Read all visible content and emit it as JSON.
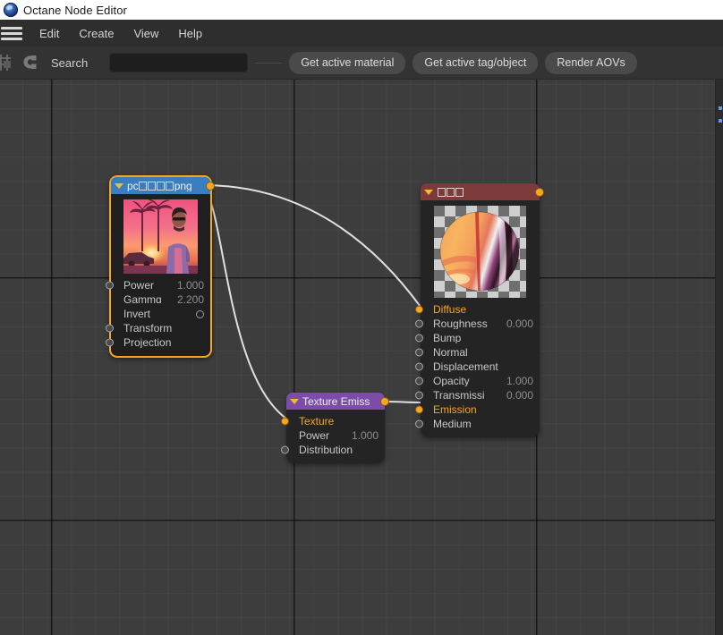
{
  "window": {
    "title": "Octane Node Editor",
    "logo_icon": "octane-logo-icon"
  },
  "menubar": {
    "hamburger_icon": "hamburger-menu-icon",
    "items": [
      {
        "label": "Edit"
      },
      {
        "label": "Create"
      },
      {
        "label": "View"
      },
      {
        "label": "Help"
      }
    ]
  },
  "toolbar": {
    "icons": [
      {
        "name": "node-graph-icon"
      },
      {
        "name": "magnet-snap-icon"
      }
    ],
    "search_label": "Search",
    "search_value": "",
    "search_placeholder": "",
    "buttons": [
      {
        "label": "Get active material"
      },
      {
        "label": "Get active tag/object"
      },
      {
        "label": "Render AOVs"
      }
    ]
  },
  "canvas": {
    "background_color": "#3d3d3d",
    "grid_minor_color": "#474747",
    "grid_major_color": "#262626",
    "wire_color": "#e0e0e0"
  },
  "nodes": {
    "image": {
      "title_prefix": "pc",
      "title_tofu_count": 4,
      "title_suffix": "png",
      "title_color": "#3a7ebf",
      "selected": true,
      "thumbnail": "sunset-palm-tree-portrait-thumbnail",
      "rows": [
        {
          "label": "Power",
          "value": "1.000",
          "port": true,
          "linked": false,
          "checkbox": false
        },
        {
          "label": "Gammɑ",
          "value": "2.200",
          "port": false,
          "linked": false,
          "checkbox": false
        },
        {
          "label": "Invert",
          "value": "",
          "port": false,
          "linked": false,
          "checkbox": true
        },
        {
          "label": "Transform",
          "value": "",
          "port": true,
          "linked": false,
          "checkbox": false
        },
        {
          "label": "Projection",
          "value": "",
          "port": true,
          "linked": false,
          "checkbox": false
        }
      ]
    },
    "material": {
      "title_prefix": "",
      "title_tofu_count": 3,
      "title_suffix": "",
      "title_color": "#7d3a3a",
      "selected": false,
      "thumbnail": "material-sphere-preview-thumbnail",
      "rows": [
        {
          "label": "Diffuse",
          "value": "",
          "port": true,
          "linked": true,
          "checkbox": false
        },
        {
          "label": "Roughness",
          "value": "0.000",
          "port": true,
          "linked": false,
          "checkbox": false
        },
        {
          "label": "Bump",
          "value": "",
          "port": true,
          "linked": false,
          "checkbox": false
        },
        {
          "label": "Normal",
          "value": "",
          "port": true,
          "linked": false,
          "checkbox": false
        },
        {
          "label": "Displacement",
          "value": "",
          "port": true,
          "linked": false,
          "checkbox": false
        },
        {
          "label": "Opacity",
          "value": "1.000",
          "port": true,
          "linked": false,
          "checkbox": false
        },
        {
          "label": "Transmissi",
          "value": "0.000",
          "port": true,
          "linked": false,
          "checkbox": false
        },
        {
          "label": "Emission",
          "value": "",
          "port": true,
          "linked": true,
          "checkbox": false
        },
        {
          "label": "Medium",
          "value": "",
          "port": true,
          "linked": false,
          "checkbox": false
        }
      ]
    },
    "emission": {
      "title_prefix": "Texture Emiss",
      "title_tofu_count": 0,
      "title_suffix": "",
      "title_color": "#7b4da8",
      "selected": false,
      "thumbnail": null,
      "rows": [
        {
          "label": "Texture",
          "value": "",
          "port": true,
          "linked": true,
          "checkbox": false
        },
        {
          "label": "Power",
          "value": "1.000",
          "port": false,
          "linked": false,
          "checkbox": false
        },
        {
          "label": "Distribution",
          "value": "",
          "port": true,
          "linked": false,
          "checkbox": false
        }
      ]
    }
  },
  "connections": [
    {
      "from": "image.output",
      "to": "material.Diffuse"
    },
    {
      "from": "image.output",
      "to": "emission.Texture"
    },
    {
      "from": "emission.output",
      "to": "material.Emission"
    }
  ]
}
